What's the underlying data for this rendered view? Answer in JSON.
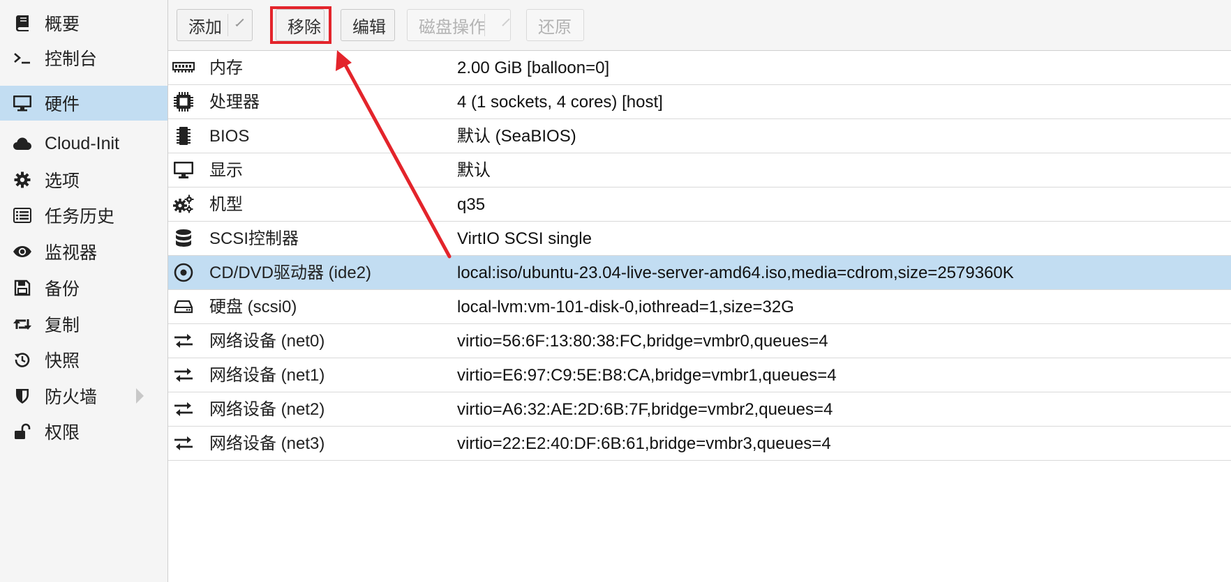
{
  "sidebar": {
    "items": [
      {
        "label": "概要",
        "icon": "book-icon"
      },
      {
        "label": "控制台",
        "icon": "terminal-icon"
      },
      {
        "label": "硬件",
        "icon": "monitor-icon",
        "active": true
      },
      {
        "label": "Cloud-Init",
        "icon": "cloud-icon"
      },
      {
        "label": "选项",
        "icon": "gear-icon"
      },
      {
        "label": "任务历史",
        "icon": "list-icon"
      },
      {
        "label": "监视器",
        "icon": "eye-icon"
      },
      {
        "label": "备份",
        "icon": "floppy-icon"
      },
      {
        "label": "复制",
        "icon": "retweet-icon"
      },
      {
        "label": "快照",
        "icon": "history-icon"
      },
      {
        "label": "防火墙",
        "icon": "shield-icon",
        "expandable": true
      },
      {
        "label": "权限",
        "icon": "unlock-icon"
      }
    ]
  },
  "toolbar": {
    "add_label": "添加",
    "remove_label": "移除",
    "edit_label": "编辑",
    "disk_action_label": "磁盘操作",
    "revert_label": "还原"
  },
  "hardware": {
    "rows": [
      {
        "name": "内存",
        "value": "2.00 GiB [balloon=0]",
        "icon": "memory-icon"
      },
      {
        "name": "处理器",
        "value": "4 (1 sockets, 4 cores) [host]",
        "icon": "cpu-icon"
      },
      {
        "name": "BIOS",
        "value": "默认 (SeaBIOS)",
        "icon": "microchip-icon"
      },
      {
        "name": "显示",
        "value": "默认",
        "icon": "desktop-icon"
      },
      {
        "name": "机型",
        "value": "q35",
        "icon": "cogs-icon"
      },
      {
        "name": "SCSI控制器",
        "value": "VirtIO SCSI single",
        "icon": "database-icon"
      },
      {
        "name": "CD/DVD驱动器 (ide2)",
        "value": "local:iso/ubuntu-23.04-live-server-amd64.iso,media=cdrom,size=2579360K",
        "icon": "cdrom-icon",
        "selected": true
      },
      {
        "name": "硬盘 (scsi0)",
        "value": "local-lvm:vm-101-disk-0,iothread=1,size=32G",
        "icon": "hdd-icon"
      },
      {
        "name": "网络设备 (net0)",
        "value": "virtio=56:6F:13:80:38:FC,bridge=vmbr0,queues=4",
        "icon": "exchange-icon"
      },
      {
        "name": "网络设备 (net1)",
        "value": "virtio=E6:97:C9:5E:B8:CA,bridge=vmbr1,queues=4",
        "icon": "exchange-icon"
      },
      {
        "name": "网络设备 (net2)",
        "value": "virtio=A6:32:AE:2D:6B:7F,bridge=vmbr2,queues=4",
        "icon": "exchange-icon"
      },
      {
        "name": "网络设备 (net3)",
        "value": "virtio=22:E2:40:DF:6B:61,bridge=vmbr3,queues=4",
        "icon": "exchange-icon"
      }
    ]
  },
  "colors": {
    "selection": "#c2ddf2",
    "annotation_red": "#e3242b"
  }
}
